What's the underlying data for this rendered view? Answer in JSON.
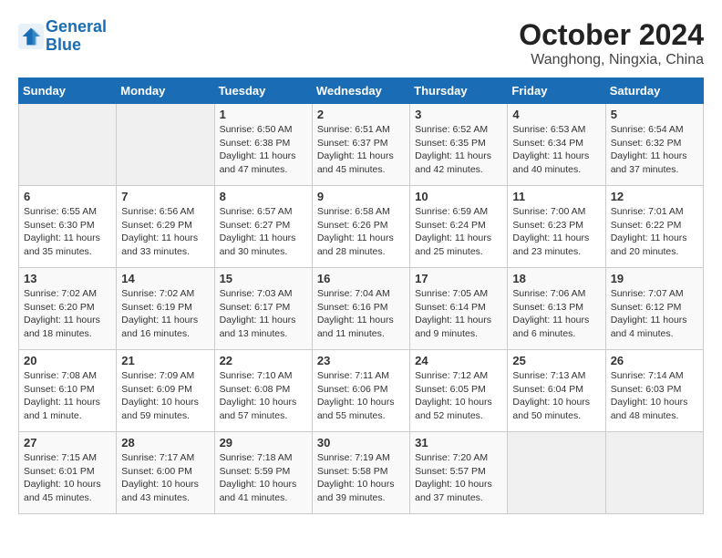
{
  "header": {
    "logo_line1": "General",
    "logo_line2": "Blue",
    "month": "October 2024",
    "location": "Wanghong, Ningxia, China"
  },
  "weekdays": [
    "Sunday",
    "Monday",
    "Tuesday",
    "Wednesday",
    "Thursday",
    "Friday",
    "Saturday"
  ],
  "weeks": [
    [
      {
        "day": "",
        "info": ""
      },
      {
        "day": "",
        "info": ""
      },
      {
        "day": "1",
        "info": "Sunrise: 6:50 AM\nSunset: 6:38 PM\nDaylight: 11 hours and 47 minutes."
      },
      {
        "day": "2",
        "info": "Sunrise: 6:51 AM\nSunset: 6:37 PM\nDaylight: 11 hours and 45 minutes."
      },
      {
        "day": "3",
        "info": "Sunrise: 6:52 AM\nSunset: 6:35 PM\nDaylight: 11 hours and 42 minutes."
      },
      {
        "day": "4",
        "info": "Sunrise: 6:53 AM\nSunset: 6:34 PM\nDaylight: 11 hours and 40 minutes."
      },
      {
        "day": "5",
        "info": "Sunrise: 6:54 AM\nSunset: 6:32 PM\nDaylight: 11 hours and 37 minutes."
      }
    ],
    [
      {
        "day": "6",
        "info": "Sunrise: 6:55 AM\nSunset: 6:30 PM\nDaylight: 11 hours and 35 minutes."
      },
      {
        "day": "7",
        "info": "Sunrise: 6:56 AM\nSunset: 6:29 PM\nDaylight: 11 hours and 33 minutes."
      },
      {
        "day": "8",
        "info": "Sunrise: 6:57 AM\nSunset: 6:27 PM\nDaylight: 11 hours and 30 minutes."
      },
      {
        "day": "9",
        "info": "Sunrise: 6:58 AM\nSunset: 6:26 PM\nDaylight: 11 hours and 28 minutes."
      },
      {
        "day": "10",
        "info": "Sunrise: 6:59 AM\nSunset: 6:24 PM\nDaylight: 11 hours and 25 minutes."
      },
      {
        "day": "11",
        "info": "Sunrise: 7:00 AM\nSunset: 6:23 PM\nDaylight: 11 hours and 23 minutes."
      },
      {
        "day": "12",
        "info": "Sunrise: 7:01 AM\nSunset: 6:22 PM\nDaylight: 11 hours and 20 minutes."
      }
    ],
    [
      {
        "day": "13",
        "info": "Sunrise: 7:02 AM\nSunset: 6:20 PM\nDaylight: 11 hours and 18 minutes."
      },
      {
        "day": "14",
        "info": "Sunrise: 7:02 AM\nSunset: 6:19 PM\nDaylight: 11 hours and 16 minutes."
      },
      {
        "day": "15",
        "info": "Sunrise: 7:03 AM\nSunset: 6:17 PM\nDaylight: 11 hours and 13 minutes."
      },
      {
        "day": "16",
        "info": "Sunrise: 7:04 AM\nSunset: 6:16 PM\nDaylight: 11 hours and 11 minutes."
      },
      {
        "day": "17",
        "info": "Sunrise: 7:05 AM\nSunset: 6:14 PM\nDaylight: 11 hours and 9 minutes."
      },
      {
        "day": "18",
        "info": "Sunrise: 7:06 AM\nSunset: 6:13 PM\nDaylight: 11 hours and 6 minutes."
      },
      {
        "day": "19",
        "info": "Sunrise: 7:07 AM\nSunset: 6:12 PM\nDaylight: 11 hours and 4 minutes."
      }
    ],
    [
      {
        "day": "20",
        "info": "Sunrise: 7:08 AM\nSunset: 6:10 PM\nDaylight: 11 hours and 1 minute."
      },
      {
        "day": "21",
        "info": "Sunrise: 7:09 AM\nSunset: 6:09 PM\nDaylight: 10 hours and 59 minutes."
      },
      {
        "day": "22",
        "info": "Sunrise: 7:10 AM\nSunset: 6:08 PM\nDaylight: 10 hours and 57 minutes."
      },
      {
        "day": "23",
        "info": "Sunrise: 7:11 AM\nSunset: 6:06 PM\nDaylight: 10 hours and 55 minutes."
      },
      {
        "day": "24",
        "info": "Sunrise: 7:12 AM\nSunset: 6:05 PM\nDaylight: 10 hours and 52 minutes."
      },
      {
        "day": "25",
        "info": "Sunrise: 7:13 AM\nSunset: 6:04 PM\nDaylight: 10 hours and 50 minutes."
      },
      {
        "day": "26",
        "info": "Sunrise: 7:14 AM\nSunset: 6:03 PM\nDaylight: 10 hours and 48 minutes."
      }
    ],
    [
      {
        "day": "27",
        "info": "Sunrise: 7:15 AM\nSunset: 6:01 PM\nDaylight: 10 hours and 45 minutes."
      },
      {
        "day": "28",
        "info": "Sunrise: 7:17 AM\nSunset: 6:00 PM\nDaylight: 10 hours and 43 minutes."
      },
      {
        "day": "29",
        "info": "Sunrise: 7:18 AM\nSunset: 5:59 PM\nDaylight: 10 hours and 41 minutes."
      },
      {
        "day": "30",
        "info": "Sunrise: 7:19 AM\nSunset: 5:58 PM\nDaylight: 10 hours and 39 minutes."
      },
      {
        "day": "31",
        "info": "Sunrise: 7:20 AM\nSunset: 5:57 PM\nDaylight: 10 hours and 37 minutes."
      },
      {
        "day": "",
        "info": ""
      },
      {
        "day": "",
        "info": ""
      }
    ]
  ]
}
